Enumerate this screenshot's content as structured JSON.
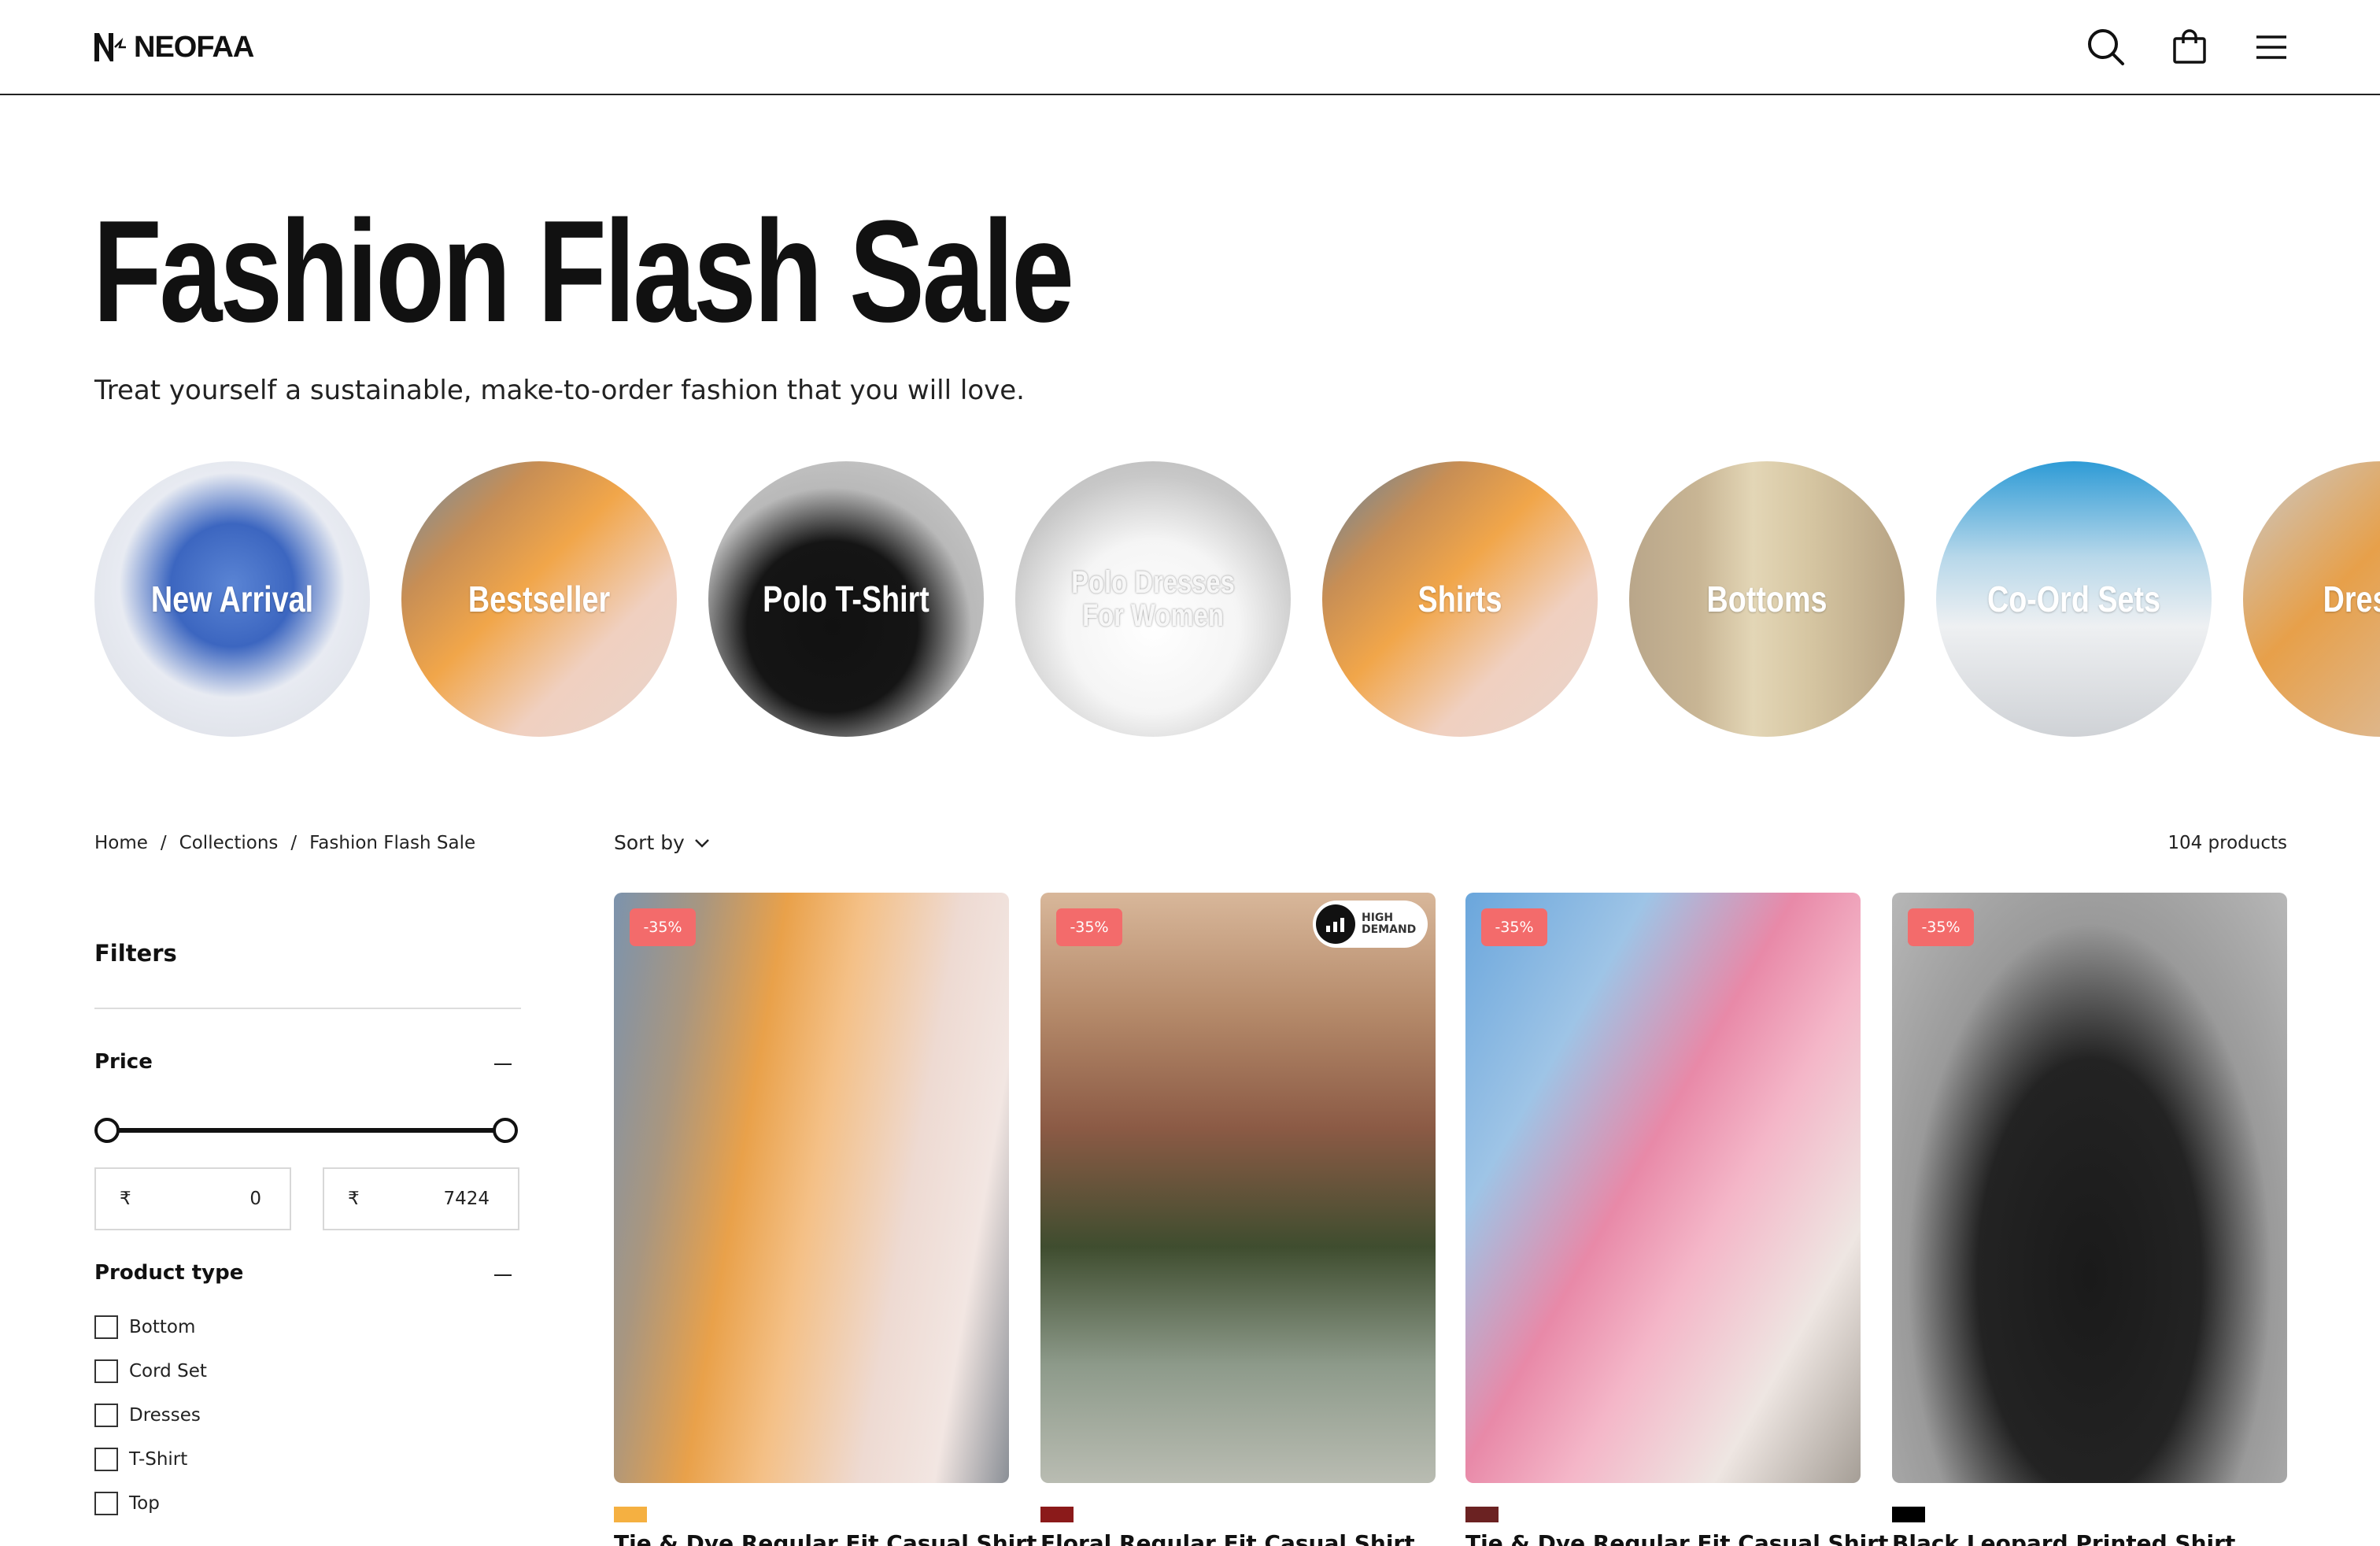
{
  "brand": {
    "name": "NEOFAA"
  },
  "header": {
    "icons": [
      "search-icon",
      "shopping-bag-icon",
      "menu-icon"
    ]
  },
  "page": {
    "title": "Fashion Flash Sale",
    "subtitle": "Treat yourself a sustainable, make-to-order fashion that you will love."
  },
  "categories": [
    {
      "label": "New Arrival"
    },
    {
      "label": "Bestseller"
    },
    {
      "label": "Polo T-Shirt"
    },
    {
      "label": "Polo Dresses For Women"
    },
    {
      "label": "Shirts"
    },
    {
      "label": "Bottoms"
    },
    {
      "label": "Co-Ord Sets"
    },
    {
      "label": "Dresses"
    }
  ],
  "breadcrumb": {
    "home": "Home",
    "sep": "/",
    "collections": "Collections",
    "current": "Fashion Flash Sale"
  },
  "toolbar": {
    "sort_label": "Sort by",
    "product_count": "104 products"
  },
  "filters": {
    "title": "Filters",
    "price": {
      "label": "Price",
      "currency": "₹",
      "min": "0",
      "max": "7424",
      "selected_min_fraction": 0,
      "selected_max_fraction": 1
    },
    "product_type": {
      "label": "Product type",
      "options": [
        {
          "label": "Bottom",
          "checked": false
        },
        {
          "label": "Cord Set",
          "checked": false
        },
        {
          "label": "Dresses",
          "checked": false
        },
        {
          "label": "T-Shirt",
          "checked": false
        },
        {
          "label": "Top",
          "checked": false
        }
      ]
    }
  },
  "products": [
    {
      "badge": "-35%",
      "name": "Tie & Dye Regular Fit Casual Shirt",
      "swatch": "#f5b041"
    },
    {
      "badge": "-35%",
      "demand_badge": "HIGH DEMAND",
      "name": "Floral Regular Fit Casual Shirt",
      "swatch": "#8b1a1a"
    },
    {
      "badge": "-35%",
      "name": "Tie & Dye Regular Fit Casual Shirt",
      "swatch": "#6b2222"
    },
    {
      "badge": "-35%",
      "name": "Black Leopard Printed Shirt",
      "swatch": "#000000"
    }
  ],
  "colors": {
    "sale_badge": "#f36b6b",
    "text": "#111111"
  }
}
